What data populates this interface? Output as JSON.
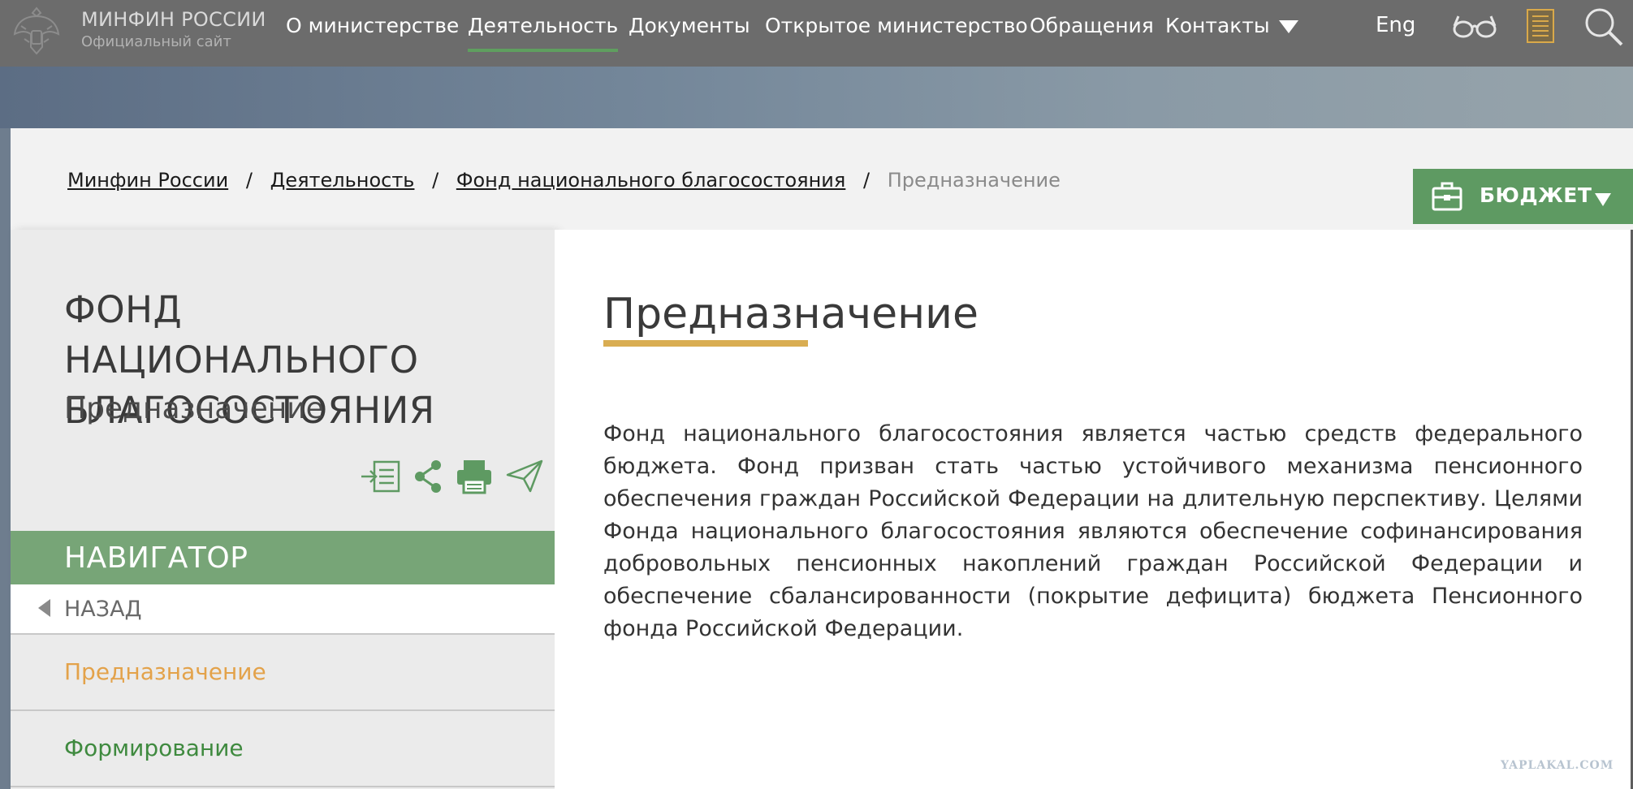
{
  "header": {
    "logo_title": "МИНФИН РОССИИ",
    "logo_subtitle": "Официальный сайт",
    "nav": [
      {
        "label": "О министерстве"
      },
      {
        "label": "Деятельность",
        "active": true
      },
      {
        "label": "Документы"
      },
      {
        "label": "Открытое министерство"
      },
      {
        "label": "Обращения"
      },
      {
        "label": "Контакты"
      }
    ],
    "language": "Eng",
    "icons": [
      "eye-glasses-icon",
      "document-icon",
      "search-icon"
    ]
  },
  "breadcrumb": {
    "items": [
      "Минфин России",
      "Деятельность",
      "Фонд национального благосостояния"
    ],
    "separator": "/",
    "current": "Предназначение"
  },
  "budget_button": {
    "label": "БЮДЖЕТ",
    "icon": "briefcase-icon"
  },
  "sidebar": {
    "title": "ФОНД НАЦИОНАЛЬНОГО БЛАГОСОСТОЯНИЯ",
    "subtitle": "Предназначение",
    "tools": [
      "export-icon",
      "share-icon",
      "print-icon",
      "send-icon"
    ],
    "navigator_label": "НАВИГАТОР",
    "back_label": "НАЗАД",
    "menu": [
      {
        "label": "Предназначение",
        "current": true
      },
      {
        "label": "Формирование"
      }
    ]
  },
  "main": {
    "title": "Предназначение",
    "body": "Фонд национального благосостояния является частью средств федерального бюджета. Фонд призван стать частью устойчивого механизма пенсионного обеспечения граждан Российской Федерации на длительную перспективу. Целями Фонда национального благосостояния являются обеспечение софинансирования добровольных пенсионных накоплений граждан Российской Федерации и обеспечение сбалансированности (покрытие дефицита) бюджета Пенсионного фонда Российской Федерации."
  },
  "watermark": "YAPLAKAL.COM",
  "colors": {
    "topbar": "#6c6c6c",
    "accent_green": "#5e9a62",
    "navigator_green": "#77a577",
    "current_item": "#e3a24a",
    "title_underline": "#d9ad52"
  }
}
